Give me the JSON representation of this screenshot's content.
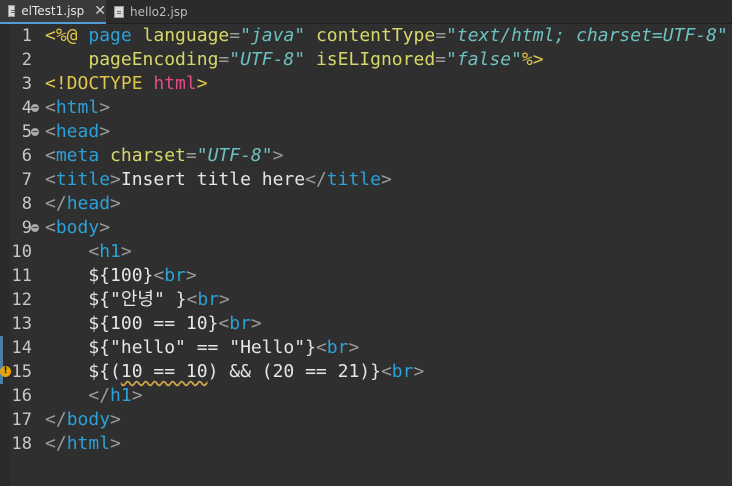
{
  "tabs": [
    {
      "label": "elTest1.jsp",
      "active": true,
      "close": "✕"
    },
    {
      "label": "hello2.jsp",
      "active": false
    }
  ],
  "lines": [
    {
      "n": "1",
      "tokens": [
        [
          "c-dir",
          "<%@ "
        ],
        [
          "c-kw",
          "page "
        ],
        [
          "c-attr",
          "language"
        ],
        [
          "c-punct",
          "="
        ],
        [
          "c-str",
          "\"java\""
        ],
        [
          "c-punct",
          " "
        ],
        [
          "c-attr",
          "contentType"
        ],
        [
          "c-punct",
          "="
        ],
        [
          "c-str",
          "\"text/html; charset=UTF-8\""
        ]
      ]
    },
    {
      "n": "2",
      "tokens": [
        [
          "c-text",
          "    "
        ],
        [
          "c-attr",
          "pageEncoding"
        ],
        [
          "c-punct",
          "="
        ],
        [
          "c-str",
          "\"UTF-8\""
        ],
        [
          "c-punct",
          " "
        ],
        [
          "c-attr",
          "isELIgnored"
        ],
        [
          "c-punct",
          "="
        ],
        [
          "c-str",
          "\"false\""
        ],
        [
          "c-dir",
          "%>"
        ]
      ]
    },
    {
      "n": "3",
      "tokens": [
        [
          "c-doctype",
          "<!DOCTYPE "
        ],
        [
          "c-html-kw",
          "html"
        ],
        [
          "c-doctype",
          ">"
        ]
      ]
    },
    {
      "n": "4",
      "fold": true,
      "tokens": [
        [
          "c-punct",
          "<"
        ],
        [
          "c-tag",
          "html"
        ],
        [
          "c-punct",
          ">"
        ]
      ]
    },
    {
      "n": "5",
      "fold": true,
      "tokens": [
        [
          "c-punct",
          "<"
        ],
        [
          "c-tag",
          "head"
        ],
        [
          "c-punct",
          ">"
        ]
      ]
    },
    {
      "n": "6",
      "tokens": [
        [
          "c-punct",
          "<"
        ],
        [
          "c-tag",
          "meta "
        ],
        [
          "c-attr",
          "charset"
        ],
        [
          "c-punct",
          "="
        ],
        [
          "c-str",
          "\"UTF-8\""
        ],
        [
          "c-punct",
          ">"
        ]
      ]
    },
    {
      "n": "7",
      "tokens": [
        [
          "c-punct",
          "<"
        ],
        [
          "c-tag",
          "title"
        ],
        [
          "c-punct",
          ">"
        ],
        [
          "c-text",
          "Insert title here"
        ],
        [
          "c-punct",
          "</"
        ],
        [
          "c-tag",
          "title"
        ],
        [
          "c-punct",
          ">"
        ]
      ]
    },
    {
      "n": "8",
      "tokens": [
        [
          "c-punct",
          "</"
        ],
        [
          "c-tag",
          "head"
        ],
        [
          "c-punct",
          ">"
        ]
      ]
    },
    {
      "n": "9",
      "fold": true,
      "tokens": [
        [
          "c-punct",
          "<"
        ],
        [
          "c-tag",
          "body"
        ],
        [
          "c-punct",
          ">"
        ]
      ]
    },
    {
      "n": "10",
      "tokens": [
        [
          "c-text",
          "    "
        ],
        [
          "c-punct",
          "<"
        ],
        [
          "c-tag",
          "h1"
        ],
        [
          "c-punct",
          ">"
        ]
      ]
    },
    {
      "n": "11",
      "tokens": [
        [
          "c-text",
          "    ${100}"
        ],
        [
          "c-punct",
          "<"
        ],
        [
          "c-tag",
          "br"
        ],
        [
          "c-punct",
          ">"
        ]
      ]
    },
    {
      "n": "12",
      "tokens": [
        [
          "c-text",
          "    ${\"안녕\" }"
        ],
        [
          "c-punct",
          "<"
        ],
        [
          "c-tag",
          "br"
        ],
        [
          "c-punct",
          ">"
        ]
      ]
    },
    {
      "n": "13",
      "tokens": [
        [
          "c-text",
          "    ${100 == 10}"
        ],
        [
          "c-punct",
          "<"
        ],
        [
          "c-tag",
          "br"
        ],
        [
          "c-punct",
          ">"
        ]
      ]
    },
    {
      "n": "14",
      "tokens": [
        [
          "c-text",
          "    ${\"hello\" == \"Hello\"}"
        ],
        [
          "c-punct",
          "<"
        ],
        [
          "c-tag",
          "br"
        ],
        [
          "c-punct",
          ">"
        ]
      ]
    },
    {
      "n": "15",
      "tokens": [
        [
          "c-text",
          "    ${("
        ],
        [
          "warn-underline",
          "10 == 10"
        ],
        [
          "c-text",
          ") && (20 == 21)}"
        ],
        [
          "c-punct",
          "<"
        ],
        [
          "c-tag",
          "br"
        ],
        [
          "c-punct",
          ">"
        ]
      ]
    },
    {
      "n": "16",
      "tokens": [
        [
          "c-text",
          "    "
        ],
        [
          "c-punct",
          "</"
        ],
        [
          "c-tag",
          "h1"
        ],
        [
          "c-punct",
          ">"
        ]
      ]
    },
    {
      "n": "17",
      "tokens": [
        [
          "c-punct",
          "</"
        ],
        [
          "c-tag",
          "body"
        ],
        [
          "c-punct",
          ">"
        ]
      ]
    },
    {
      "n": "18",
      "tokens": [
        [
          "c-punct",
          "</"
        ],
        [
          "c-tag",
          "html"
        ],
        [
          "c-punct",
          ">"
        ]
      ]
    }
  ],
  "warning": {
    "line": "15",
    "icon": "warning-icon",
    "glyph": "!"
  },
  "marker_lines": [
    "14",
    "15"
  ],
  "colors": {
    "background": "#2f2f2f",
    "tag": "#2aa1d8",
    "attribute": "#d8d86a",
    "string": "#6ec1c1",
    "directive": "#e0c64a",
    "warning": "#e5a50a"
  }
}
